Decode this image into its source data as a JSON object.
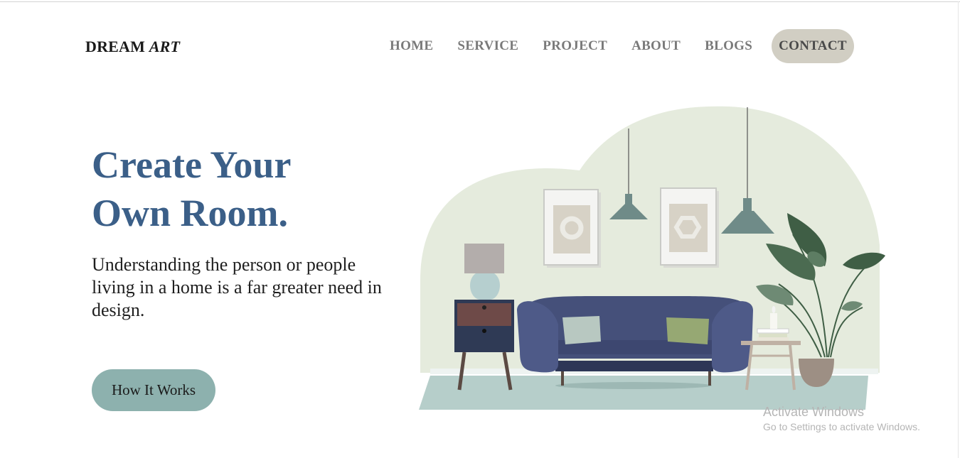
{
  "brand": {
    "logo_main": "DREAM",
    "logo_accent": "ART"
  },
  "nav": {
    "items": [
      {
        "label": "HOME"
      },
      {
        "label": "SERVICE"
      },
      {
        "label": "PROJECT"
      },
      {
        "label": "ABOUT"
      },
      {
        "label": "BLOGS"
      },
      {
        "label": "CONTACT"
      }
    ]
  },
  "hero": {
    "headline_line1": "Create Your",
    "headline_line2": "Own Room.",
    "subtext": "Understanding the person or people living in a home is a far greater need in design.",
    "cta_label": "How It Works"
  },
  "illustration": {
    "icons": [
      "living-room-illustration",
      "pendant-lamp-icon",
      "picture-frame-icon",
      "sofa-icon",
      "table-lamp-icon",
      "nightstand-icon",
      "side-table-icon",
      "candle-icon",
      "potted-plant-icon",
      "rug-icon"
    ],
    "colors": {
      "backdrop": "#e5ebdd",
      "sofa": "#45507a",
      "rug": "#b6ceca",
      "lamp": "#6f8b88",
      "plant": "#3f5e45",
      "nightstand_top": "#6e4a48",
      "nightstand_bottom": "#2f3a55"
    }
  },
  "watermark": {
    "line1": "Activate Windows",
    "line2": "Go to Settings to activate Windows."
  },
  "colors": {
    "headline": "#3b5f88",
    "cta_bg": "#8db1ae",
    "contact_bg": "#d1cec3",
    "nav_text": "#7a7a7a"
  }
}
